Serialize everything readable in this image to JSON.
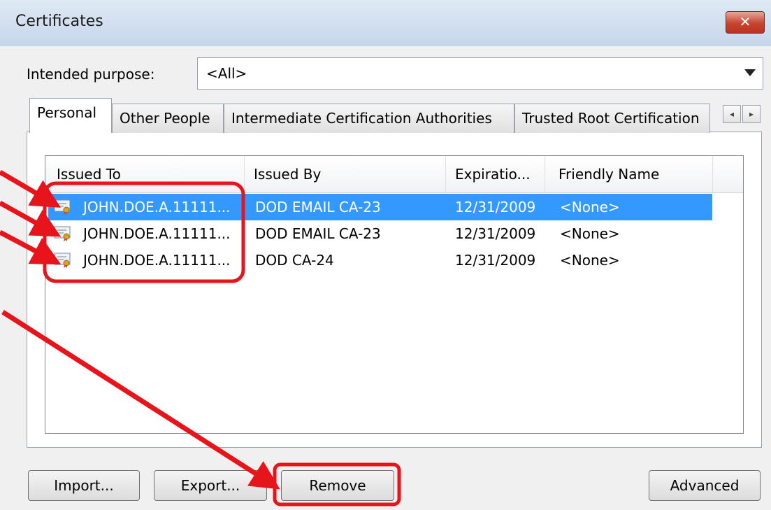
{
  "window": {
    "title": "Certificates",
    "close_label": "✕"
  },
  "purpose": {
    "label": "Intended purpose:",
    "selected": "<All>"
  },
  "tabs": [
    {
      "label": "Personal"
    },
    {
      "label": "Other People"
    },
    {
      "label": "Intermediate Certification Authorities"
    },
    {
      "label": "Trusted Root Certification"
    }
  ],
  "tab_scroll": {
    "left": "◂",
    "right": "▸"
  },
  "table": {
    "columns": [
      "Issued To",
      "Issued By",
      "Expiratio...",
      "Friendly Name"
    ],
    "rows": [
      {
        "issued_to": "JOHN.DOE.A.11111...",
        "issued_by": "DOD EMAIL CA-23",
        "expiration": "12/31/2009",
        "friendly_name": "<None>",
        "selected": true
      },
      {
        "issued_to": "JOHN.DOE.A.11111...",
        "issued_by": "DOD EMAIL CA-23",
        "expiration": "12/31/2009",
        "friendly_name": "<None>",
        "selected": false
      },
      {
        "issued_to": "JOHN.DOE.A.11111...",
        "issued_by": "DOD CA-24",
        "expiration": "12/31/2009",
        "friendly_name": "<None>",
        "selected": false
      }
    ]
  },
  "buttons": {
    "import": "Import...",
    "export": "Export...",
    "remove": "Remove",
    "advanced": "Advanced"
  },
  "colors": {
    "selection": "#3399ff",
    "annotation": "#e8141b"
  },
  "icons": {
    "certificate": "certificate-icon"
  }
}
